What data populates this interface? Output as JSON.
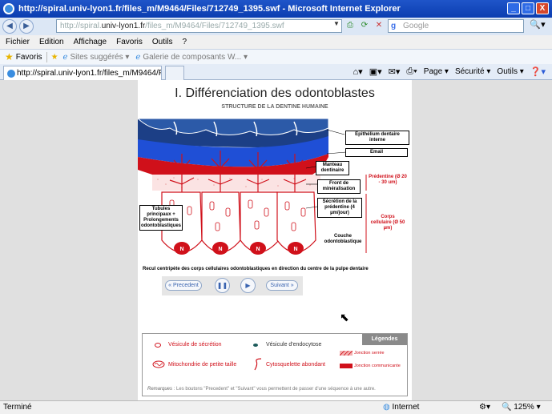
{
  "window": {
    "title": "http://spiral.univ-lyon1.fr/files_m/M9464/Files/712749_1395.swf - Microsoft Internet Explorer",
    "minimize": "_",
    "maximize": "□",
    "close": "X"
  },
  "address": {
    "prefix": "http://spiral.",
    "domain": "univ-lyon1.fr",
    "path": "/files_m/M9464/Files/712749_1395.swf"
  },
  "search": {
    "engine": "g",
    "placeholder": "Google"
  },
  "menu": [
    "Fichier",
    "Edition",
    "Affichage",
    "Favoris",
    "Outils",
    "?"
  ],
  "favorites": {
    "label": "Favoris",
    "item1": "Sites suggérés ▾",
    "item2": "Galerie de composants W... ▾"
  },
  "tab": {
    "label": "http://spiral.univ-lyon1.fr/files_m/M9464/Files/71274..."
  },
  "commands": {
    "page": "Page ▾",
    "security": "Sécurité ▾",
    "tools": "Outils ▾"
  },
  "slide": {
    "title": "I. Différenciation des odontoblastes",
    "subtitle": "STRUCTURE DE LA DENTINE HUMAINE",
    "labels": {
      "epithelium": "Épithélium dentaire interne",
      "email": "Email",
      "manteau": "Manteau dentinaire",
      "front": "Front de minéralisation",
      "secretion": "Sécrétion de la prédentine (4 µm/jour)",
      "tubules": "Tubules principaux + Prolongements odontoblastiques",
      "predentine": "Prédentine (Ø 20 - 30 um)",
      "corps": "Corps cellulaire (Ø 50 µm)",
      "couche": "Couche odontoblastique"
    },
    "caption": "Recul centripète des corps cellulaires odontoblastiques en direction du centre de la pulpe dentaire",
    "controls": {
      "prev": "« Precedent",
      "pause": "❚❚",
      "play": "▶",
      "next": "Suivant »"
    },
    "legend": {
      "title": "Légendes",
      "secretion": "Vésicule de sécrétion",
      "endocytose": "Vésicule d'endocytose",
      "mito": "Mitochondrie de petite taille",
      "cyto": "Cytosquelette abondant",
      "serree": "Jonction serrée",
      "comm": "Jonction communicante",
      "remark_label": "Remarques",
      "remark": ": Les boutons \"Precedent\" et \"Suivant\" vous permettent de passer d'une séquence à une autre."
    }
  },
  "status": {
    "done": "Terminé",
    "zone": "Internet",
    "zoom": "125%"
  },
  "colors": {
    "red": "#d0101a",
    "blue": "#1f4fd6",
    "navy": "#1c3f86"
  }
}
